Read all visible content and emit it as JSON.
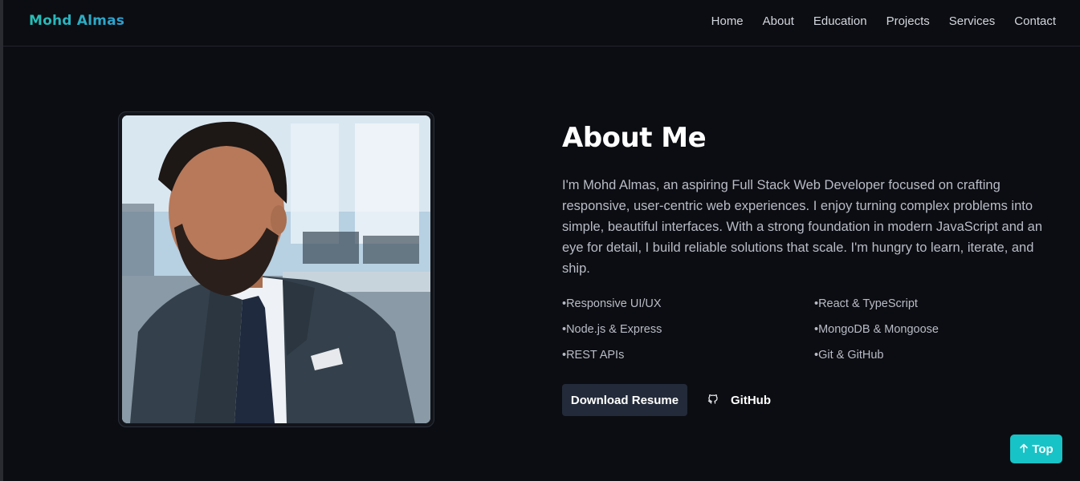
{
  "brand": "Mohd Almas",
  "nav": {
    "items": [
      {
        "label": "Home"
      },
      {
        "label": "About"
      },
      {
        "label": "Education"
      },
      {
        "label": "Projects"
      },
      {
        "label": "Services"
      },
      {
        "label": "Contact"
      }
    ]
  },
  "about": {
    "title": "About Me",
    "text": "I'm Mohd Almas, an aspiring Full Stack Web Developer focused on crafting responsive, user-centric web experiences. I enjoy turning complex problems into simple, beautiful interfaces. With a strong foundation in modern JavaScript and an eye for detail, I build reliable solutions that scale. I'm hungry to learn, iterate, and ship.",
    "skills": [
      "Responsive UI/UX",
      "React & TypeScript",
      "Node.js & Express",
      "MongoDB & Mongoose",
      "REST APIs",
      "Git & GitHub"
    ]
  },
  "actions": {
    "resume_label": "Download Resume",
    "github_label": "GitHub",
    "github_icon": "github-icon"
  },
  "scroll_top": {
    "label": "Top",
    "icon": "arrow-up-icon"
  },
  "colors": {
    "background": "#0c0d12",
    "accent": "#17c3c6",
    "button_dark": "#232a39"
  }
}
